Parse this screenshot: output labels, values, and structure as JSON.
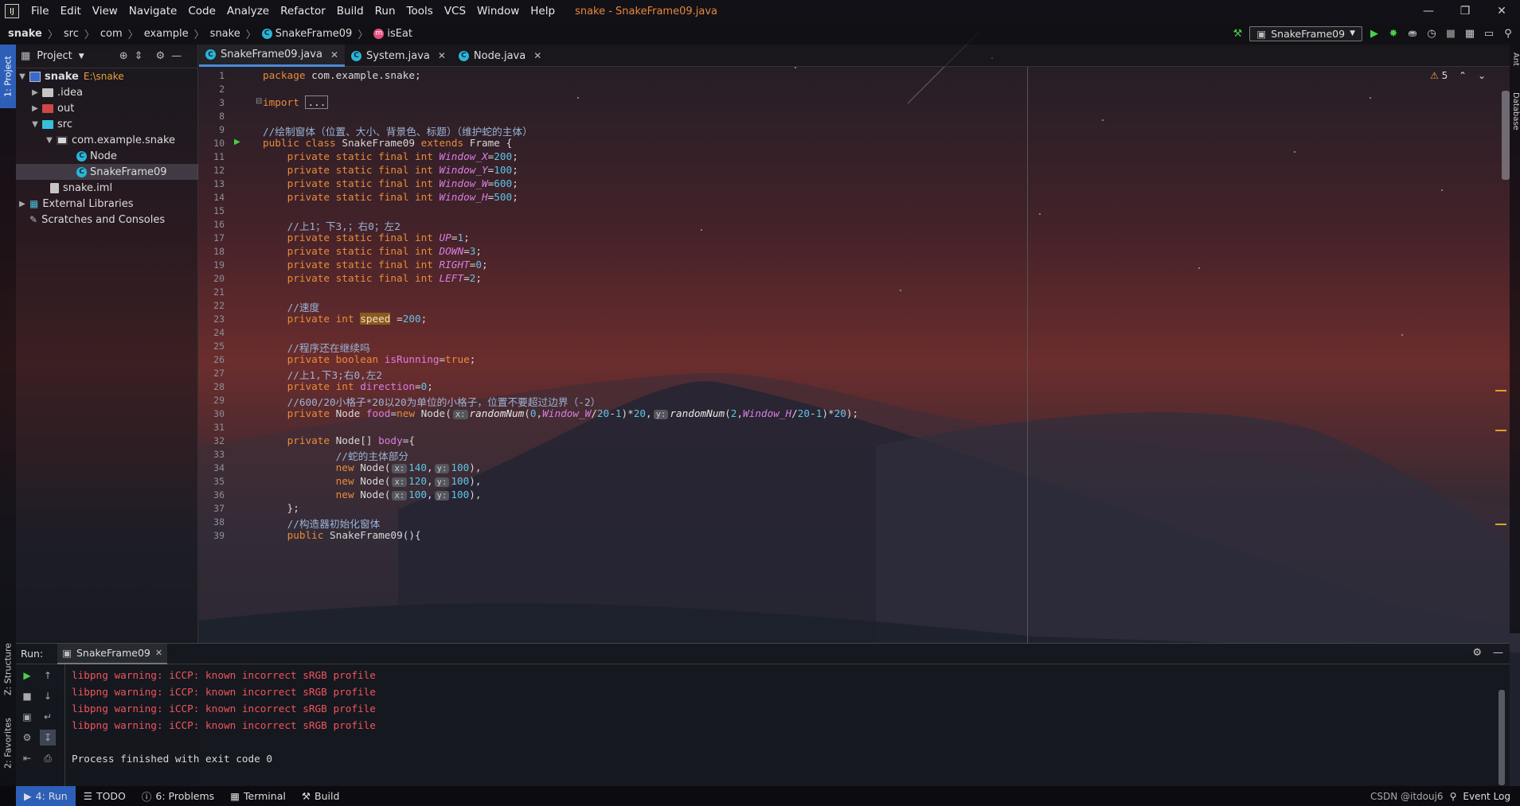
{
  "menubar": {
    "logo": "IJ",
    "items": [
      "File",
      "Edit",
      "View",
      "Navigate",
      "Code",
      "Analyze",
      "Refactor",
      "Build",
      "Run",
      "Tools",
      "VCS",
      "Window",
      "Help"
    ],
    "window_title": "snake - SnakeFrame09.java"
  },
  "navbar": {
    "crumbs": [
      "snake",
      "src",
      "com",
      "example",
      "snake",
      "SnakeFrame09",
      "isEat"
    ]
  },
  "toolbar": {
    "run_config": "SnakeFrame09"
  },
  "left_strip": {
    "project": "1: Project",
    "structure": "Z: Structure",
    "favorites": "2: Favorites"
  },
  "right_strip": {
    "ant": "Ant",
    "database": "Database"
  },
  "project": {
    "title": "Project",
    "root_name": "snake",
    "root_path": "E:\\snake",
    "items": [
      ".idea",
      "out",
      "src",
      "com.example.snake",
      "Node",
      "SnakeFrame09",
      "snake.iml",
      "External Libraries",
      "Scratches and Consoles"
    ]
  },
  "tabs": [
    "SnakeFrame09.java",
    "System.java",
    "Node.java"
  ],
  "editor": {
    "warnings": "5",
    "lines": [
      "1",
      "2",
      "3",
      "8",
      "9",
      "10",
      "11",
      "12",
      "13",
      "14",
      "15",
      "16",
      "17",
      "18",
      "19",
      "20",
      "21",
      "22",
      "23",
      "24",
      "25",
      "26",
      "27",
      "28",
      "29",
      "30",
      "31",
      "32",
      "33",
      "34",
      "35",
      "36",
      "37",
      "38",
      "39"
    ],
    "hints": {
      "x": "x:",
      "y": "y:"
    }
  },
  "run": {
    "label": "Run:",
    "tab": "SnakeFrame09",
    "output": [
      "libpng warning: iCCP: known incorrect sRGB profile",
      "libpng warning: iCCP: known incorrect sRGB profile",
      "libpng warning: iCCP: known incorrect sRGB profile",
      "libpng warning: iCCP: known incorrect sRGB profile",
      "Process finished with exit code 0"
    ]
  },
  "statusbar": {
    "items": [
      "4: Run",
      "TODO",
      "6: Problems",
      "Terminal",
      "Build"
    ],
    "watermark": "CSDN @itdouj6",
    "event_log": "Event Log"
  },
  "colors": {
    "accent": "#2e5fb8",
    "error": "#f0545d",
    "keyword": "#e98b3a",
    "constant": "#d97ee3",
    "number": "#5ec4e8"
  }
}
